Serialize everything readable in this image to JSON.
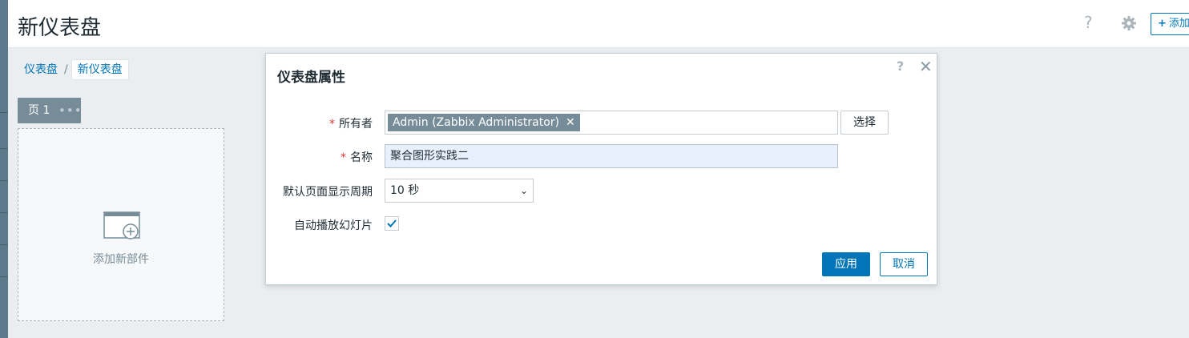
{
  "header": {
    "title": "新仪表盘",
    "help_icon": "question-mark-icon",
    "settings_icon": "gear-icon",
    "add_label": "添加"
  },
  "breadcrumb": [
    "仪表盘",
    "新仪表盘"
  ],
  "breadcrumb_sep": "/",
  "page_tab": {
    "label": "页 1",
    "more": "•••"
  },
  "widget_placeholder": {
    "label": "添加新部件",
    "icon": "add-widget-icon"
  },
  "dialog": {
    "title": "仪表盘属性",
    "help": "?",
    "close": "✕",
    "fields": {
      "owner_label": "所有者",
      "owner_value": "Admin (Zabbix Administrator)",
      "owner_remove": "✕",
      "select_label": "选择",
      "name_label": "名称",
      "name_value": "聚合图形实践二",
      "period_label": "默认页面显示周期",
      "period_value": "10 秒",
      "slideshow_label": "自动播放幻灯片",
      "slideshow_checked": true
    },
    "required_marker": "*",
    "apply_label": "应用",
    "cancel_label": "取消"
  },
  "colors": {
    "accent": "#0275b8",
    "required": "#e33734",
    "chip": "#768d99"
  }
}
